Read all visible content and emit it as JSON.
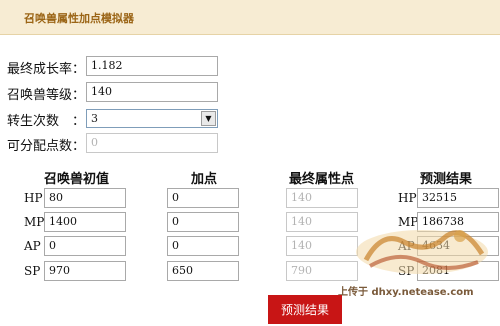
{
  "header": {
    "title": "召唤兽属性加点模拟器"
  },
  "form": {
    "growth": {
      "label": "最终成长率：",
      "value": "1.182"
    },
    "level": {
      "label": "召唤兽等级：",
      "value": "140"
    },
    "rebirth": {
      "label": "转生次数　：",
      "value": "3"
    },
    "points": {
      "label": "可分配点数：",
      "value": "0"
    }
  },
  "table": {
    "headers": {
      "initial": "召唤兽初值",
      "add": "加点",
      "final": "最终属性点",
      "predict": "预测结果"
    },
    "rows": [
      {
        "stat": "HP",
        "initial": "80",
        "add": "0",
        "final": "140",
        "predict_label": "HP",
        "predict": "32515"
      },
      {
        "stat": "MP",
        "initial": "1400",
        "add": "0",
        "final": "140",
        "predict_label": "MP",
        "predict": "186738"
      },
      {
        "stat": "AP",
        "initial": "0",
        "add": "0",
        "final": "140",
        "predict_label": "AP",
        "predict": "4634"
      },
      {
        "stat": "SP",
        "initial": "970",
        "add": "650",
        "final": "790",
        "predict_label": "SP",
        "predict": "2081"
      }
    ]
  },
  "button": {
    "label": "预测结果"
  },
  "watermark": {
    "text": "上传于 dhxy.netease.com"
  },
  "colors": {
    "header_bg": "#f7ecd3",
    "title": "#9b6516",
    "button": "#c81515"
  }
}
